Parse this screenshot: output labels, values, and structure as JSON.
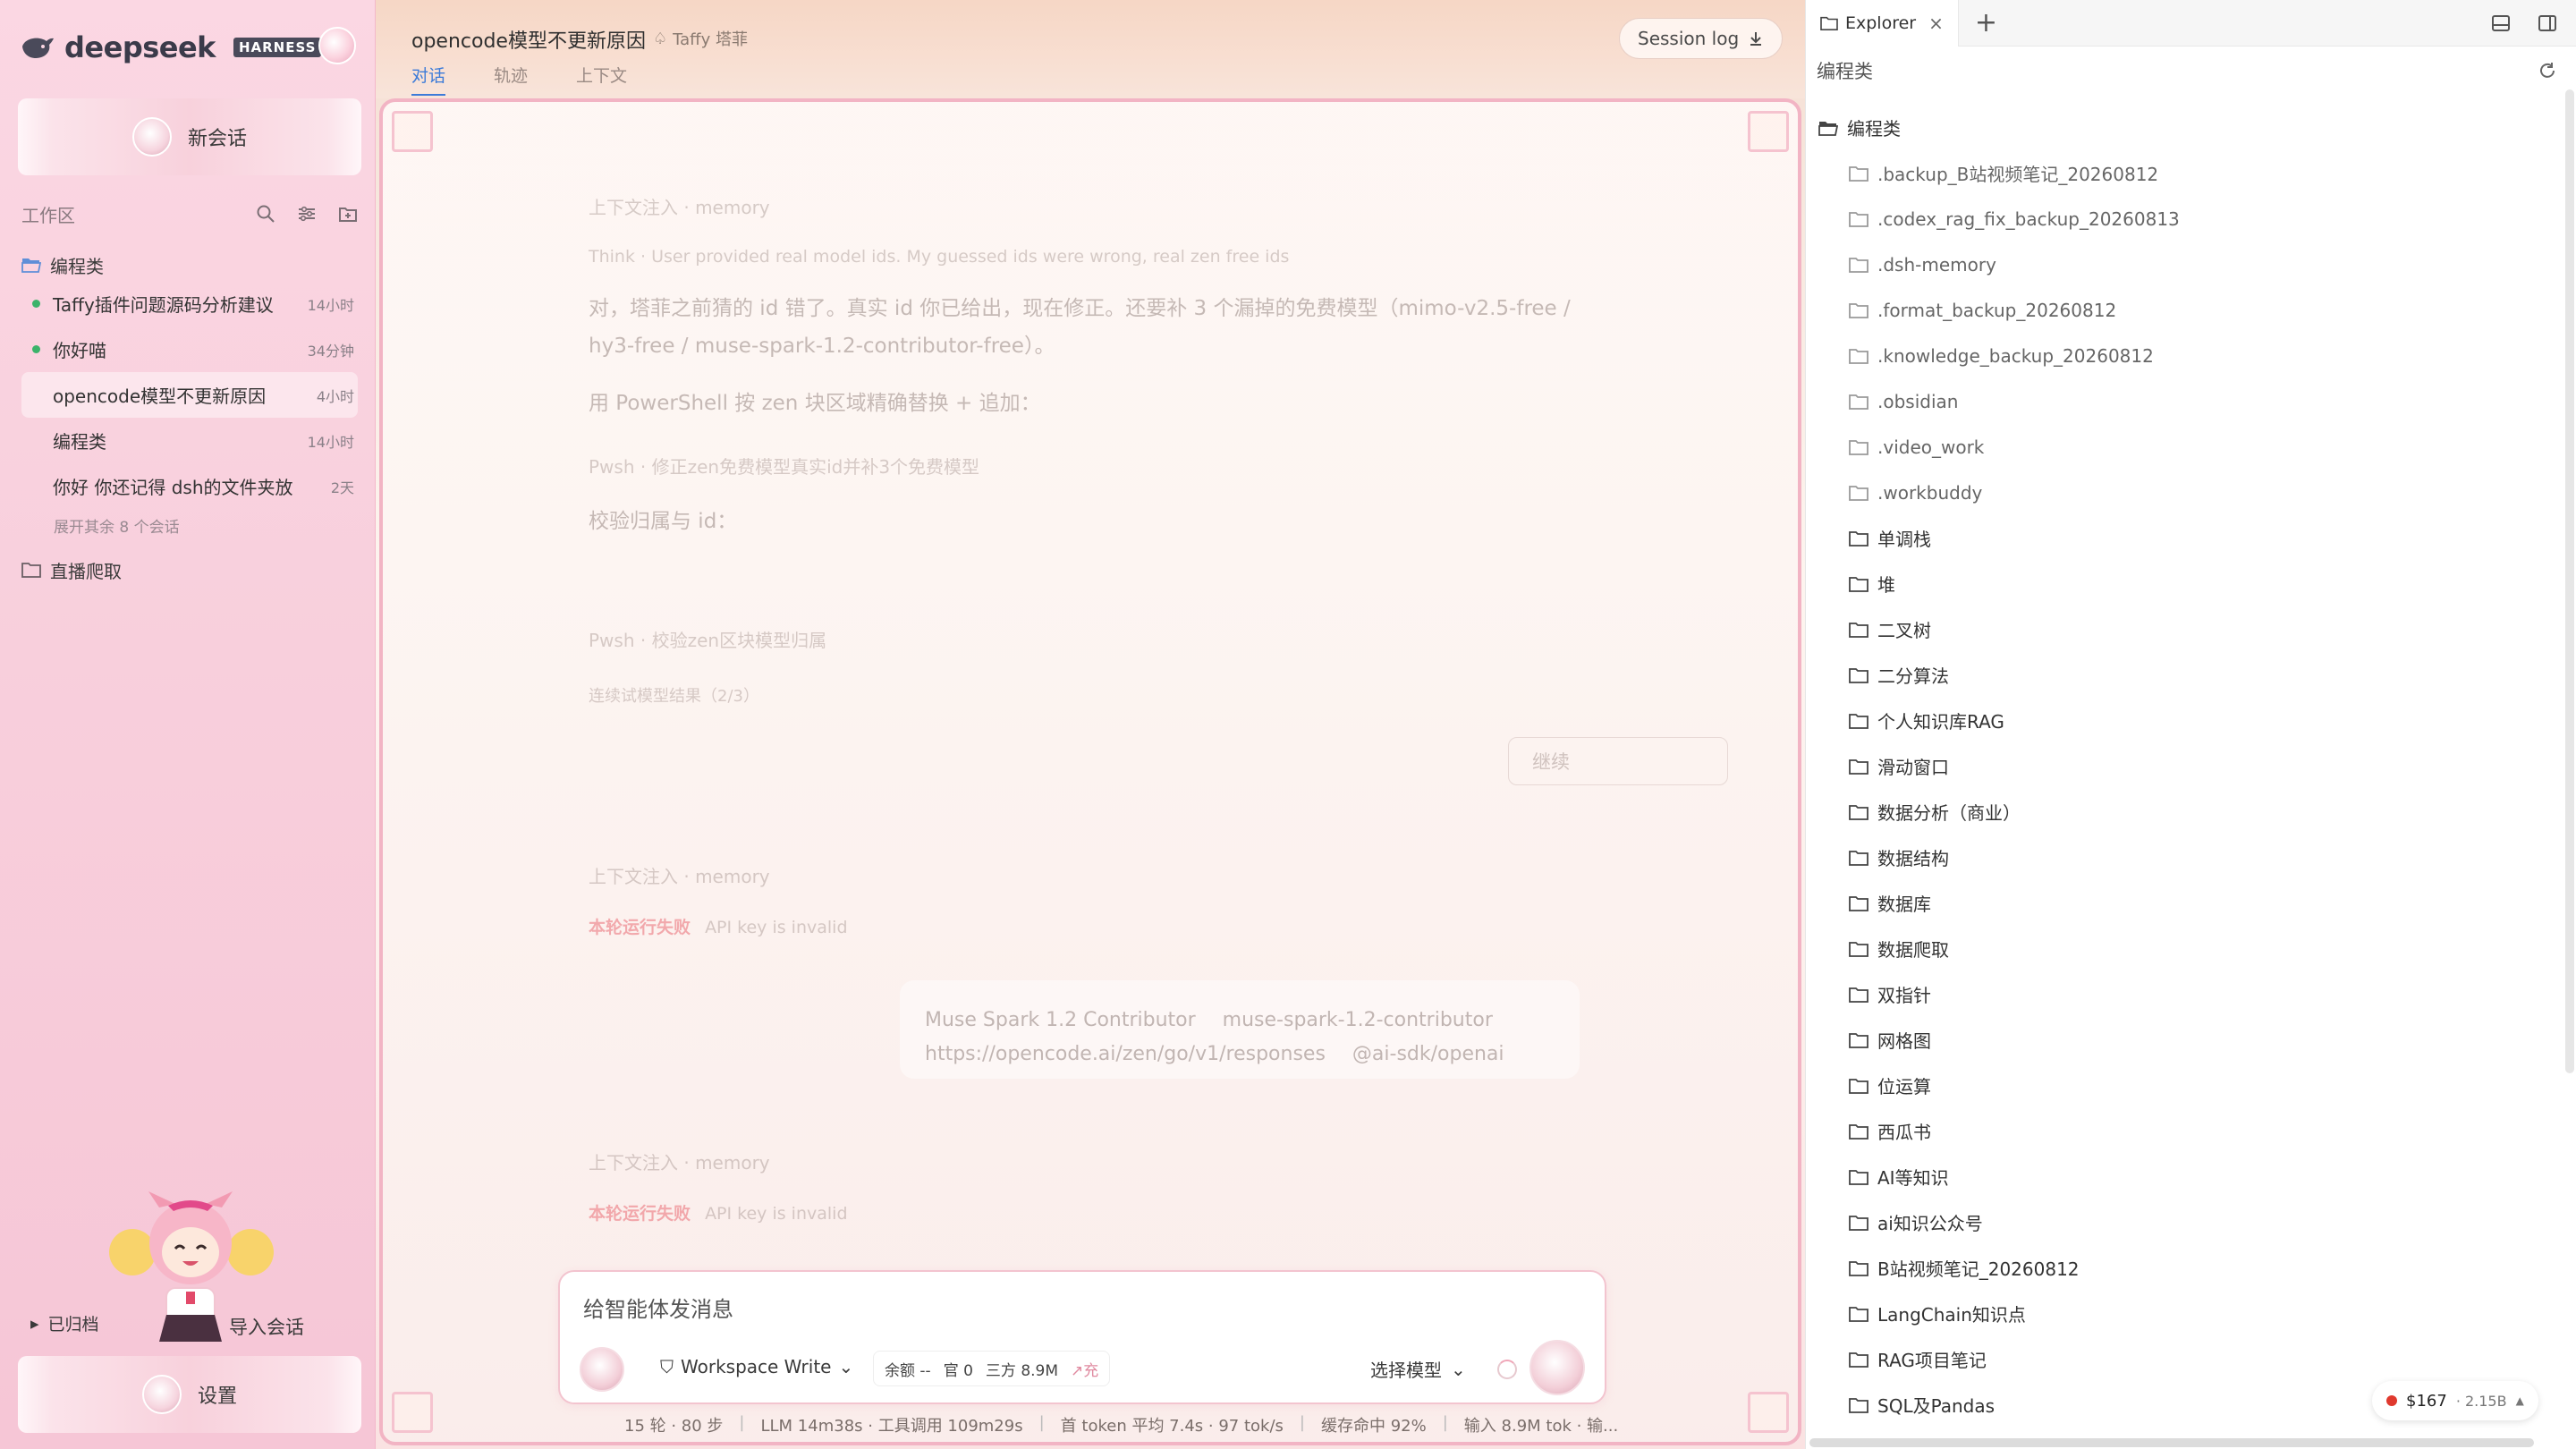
{
  "app": {
    "logo_text": "deepseek",
    "badge": "HARNESS"
  },
  "sidebar": {
    "new_chat": "新会话",
    "workspace_label": "工作区",
    "folders": [
      {
        "name": "编程类",
        "sessions": [
          {
            "title": "Taffy插件问题源码分析建议",
            "time": "14小时",
            "online": true
          },
          {
            "title": "你好喵",
            "time": "34分钟",
            "online": true
          },
          {
            "title": "opencode模型不更新原因",
            "time": "4小时",
            "online": false,
            "active": true
          },
          {
            "title": "编程类",
            "time": "14小时",
            "online": false
          },
          {
            "title": "你好 你还记得 dsh的文件夹放",
            "time": "2天",
            "online": false
          }
        ],
        "expand_more": "展开其余 8 个会话"
      },
      {
        "name": "直播爬取"
      }
    ],
    "archived": "已归档",
    "import": "导入会话",
    "settings": "设置"
  },
  "main": {
    "title": "opencode模型不更新原因",
    "agent": "Taffy 塔菲",
    "tabs": [
      "对话",
      "轨迹",
      "上下文"
    ],
    "session_log": "Session log",
    "messages": {
      "ctx1": "上下文注入 · memory",
      "think": "Think · User provided real model ids. My guessed ids were wrong, real zen free ids",
      "para1": "对，塔菲之前猜的 id 错了。真实 id 你已给出，现在修正。还要补 3 个漏掉的免费模型（mimo-v2.5-free / hy3-free / muse-spark-1.2-contributor-free）。",
      "para2": "用 PowerShell 按 zen 块区域精确替换 + 追加：",
      "pwsh1": "Pwsh · 修正zen免费模型真实id并补3个免费模型",
      "verify": "校验归属与 id：",
      "pwsh2": "Pwsh · 校验zen区块模型归属",
      "retry": "连续试模型结果（2/3）",
      "continue": "继续",
      "ctx2": "上下文注入 · memory",
      "fail1_label": "本轮运行失败",
      "fail1_text": "API key is invalid",
      "model_card_name": "Muse Spark 1.2 Contributor",
      "model_card_id": "muse-spark-1.2-contributor",
      "model_card_url": "https://opencode.ai/zen/go/v1/responses",
      "model_card_sdk": "@ai-sdk/openai",
      "ctx3": "上下文注入 · memory",
      "fail2_label": "本轮运行失败",
      "fail2_text": "API key is invalid"
    },
    "composer": {
      "placeholder": "给智能体发消息",
      "mode": "Workspace Write",
      "quota_balance": "余额 --",
      "quota_official": "官 0",
      "quota_third": "三方 8.9M",
      "quota_charge": "↗充",
      "model_select": "选择模型"
    },
    "status": {
      "rounds": "15 轮 · 80 步",
      "llm": "LLM 14m38s · 工具调用 109m29s",
      "first_token": "首 token 平均 7.4s · 97 tok/s",
      "cache": "缓存命中 92%",
      "input": "输入 8.9M tok · 输..."
    }
  },
  "explorer": {
    "tab_label": "Explorer",
    "title": "编程类",
    "root": "编程类",
    "items": [
      ".backup_B站视频笔记_20260812",
      ".codex_rag_fix_backup_20260813",
      ".dsh-memory",
      ".format_backup_20260812",
      ".knowledge_backup_20260812",
      ".obsidian",
      ".video_work",
      ".workbuddy",
      "单调栈",
      "堆",
      "二叉树",
      "二分算法",
      "个人知识库RAG",
      "滑动窗口",
      "数据分析（商业）",
      "数据结构",
      "数据库",
      "数据爬取",
      "双指针",
      "网格图",
      "位运算",
      "西瓜书",
      "AI等知识",
      "ai知识公众号",
      "B站视频笔记_20260812",
      "LangChain知识点",
      "RAG项目笔记",
      "SQL及Pandas"
    ],
    "cost": "$167",
    "tokens": "· 2.15B"
  }
}
